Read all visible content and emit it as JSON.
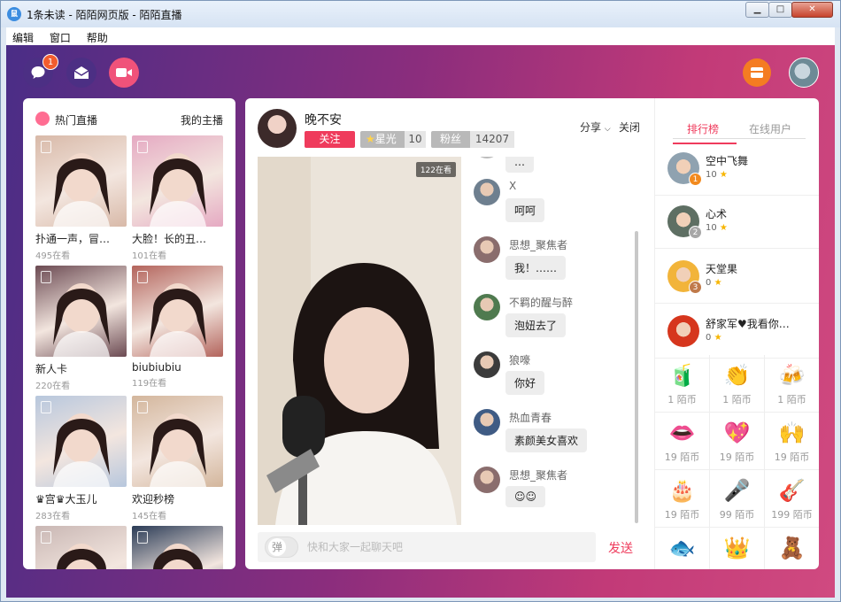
{
  "window": {
    "title": "1条未读 - 陌陌网页版 - 陌陌直播",
    "logo_text": "鼠"
  },
  "menu": [
    "编辑",
    "窗口",
    "帮助"
  ],
  "top_icons": {
    "chat_badge": "1"
  },
  "hot": {
    "title": "热门直播",
    "my_host": "我的主播",
    "cards": [
      {
        "name": "扑通一声，冒…",
        "viewers": "495在看",
        "color": "#d8b9a8"
      },
      {
        "name": "大脸！长的丑…",
        "viewers": "101在看",
        "color": "#e5a9c2"
      },
      {
        "name": "新人卡",
        "viewers": "220在看",
        "color": "#6b4a52"
      },
      {
        "name": "biubiubiu",
        "viewers": "119在看",
        "color": "#b3645c"
      },
      {
        "name": "♛宫♛大玉儿",
        "viewers": "283在看",
        "color": "#b7c7dd"
      },
      {
        "name": "欢迎秒榜",
        "viewers": "145在看",
        "color": "#d3b69c"
      },
      {
        "name": "",
        "viewers": "",
        "color": "#c9b7b4"
      },
      {
        "name": "",
        "viewers": "",
        "color": "#2a3b56"
      }
    ]
  },
  "host": {
    "name": "晚不安",
    "follow": "关注",
    "star_label": "星光",
    "star_value": "10",
    "fans_label": "粉丝",
    "fans_value": "14207",
    "share": "分享",
    "close": "关闭",
    "viewers": "122在看"
  },
  "chat": {
    "messages": [
      {
        "name": "",
        "text": "…",
        "color": "#bbb"
      },
      {
        "name": "X",
        "text": "呵呵",
        "color": "#6e7f8f"
      },
      {
        "name": "思想_聚焦者",
        "text": "我！……",
        "color": "#8a6d6d"
      },
      {
        "name": "不羁的醒与醉",
        "text": "泡妞去了",
        "color": "#4f7a4f"
      },
      {
        "name": "狼嚎",
        "text": "你好",
        "color": "#3b3b3b"
      },
      {
        "name": "热血青春",
        "text": "素颜美女喜欢",
        "color": "#3f5b84"
      },
      {
        "name": "思想_聚焦者",
        "text": "☺☺",
        "color": "#8a6d6d"
      }
    ],
    "toggle_label": "弹",
    "placeholder": "快和大家一起聊天吧",
    "send": "发送"
  },
  "ranking": {
    "tab_rank": "排行榜",
    "tab_online": "在线用户",
    "items": [
      {
        "rank": "1",
        "name": "空中飞舞",
        "score": "10",
        "color": "#8fa2b0",
        "badge": "#f28a1e"
      },
      {
        "rank": "2",
        "name": "心术",
        "score": "10",
        "color": "#5e6f63",
        "badge": "#a7a7a7"
      },
      {
        "rank": "3",
        "name": "天堂果",
        "score": "0",
        "color": "#f2b43a",
        "badge": "#c07a4a"
      },
      {
        "rank": "",
        "name": "舒家军♥我看你…",
        "score": "0",
        "color": "#d6361d",
        "badge": ""
      }
    ]
  },
  "gifts": [
    {
      "icon": "🧃",
      "price": "1 陌币"
    },
    {
      "icon": "👏",
      "price": "1 陌币"
    },
    {
      "icon": "🍻",
      "price": "1 陌币"
    },
    {
      "icon": "👄",
      "price": "19 陌币"
    },
    {
      "icon": "💖",
      "price": "19 陌币"
    },
    {
      "icon": "🙌",
      "price": "19 陌币"
    },
    {
      "icon": "🎂",
      "price": "19 陌币"
    },
    {
      "icon": "🎤",
      "price": "99 陌币"
    },
    {
      "icon": "🎸",
      "price": "199 陌币"
    },
    {
      "icon": "🐟",
      "price": ""
    },
    {
      "icon": "👑",
      "price": ""
    },
    {
      "icon": "🧸",
      "price": ""
    }
  ]
}
